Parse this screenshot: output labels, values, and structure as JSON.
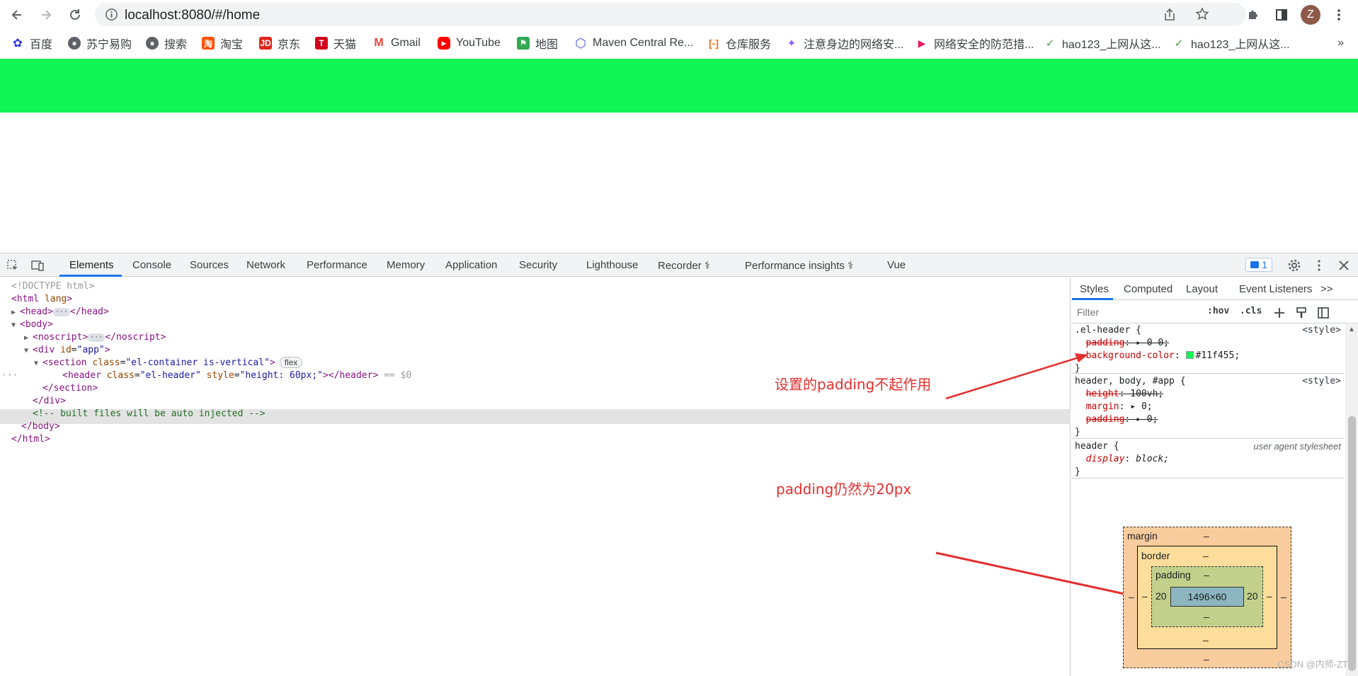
{
  "browser": {
    "url": "localhost:8080/#/home",
    "avatar_initial": "Z"
  },
  "bookmarks": [
    {
      "label": "百度",
      "icon": "baidu-icon",
      "color": "#2932e1"
    },
    {
      "label": "苏宁易购",
      "icon": "globe-icon",
      "color": "#5f6368"
    },
    {
      "label": "搜索",
      "icon": "globe-icon",
      "color": "#5f6368"
    },
    {
      "label": "淘宝",
      "icon": "taobao-icon",
      "color": "#ff5000"
    },
    {
      "label": "京东",
      "icon": "jd-icon",
      "color": "#e1251b"
    },
    {
      "label": "天猫",
      "icon": "tmall-icon",
      "color": "#d0021b"
    },
    {
      "label": "Gmail",
      "icon": "gmail-icon",
      "color": "#ea4335"
    },
    {
      "label": "YouTube",
      "icon": "youtube-icon",
      "color": "#ff0000"
    },
    {
      "label": "地图",
      "icon": "maps-icon",
      "color": "#34a853"
    },
    {
      "label": "Maven Central Re...",
      "icon": "maven-icon",
      "color": "#4f5bd5"
    },
    {
      "label": "仓库服务",
      "icon": "aliyun-icon",
      "color": "#ff6a00"
    },
    {
      "label": "注意身边的网络安...",
      "icon": "bilibili-icon",
      "color": "#8a5cf6"
    },
    {
      "label": "网络安全的防范措...",
      "icon": "play-icon",
      "color": "#e91e63"
    },
    {
      "label": "hao123_上网从这...",
      "icon": "hao123-icon",
      "color": "#3ca63c"
    },
    {
      "label": "hao123_上网从这...",
      "icon": "hao123-icon",
      "color": "#3ca63c"
    }
  ],
  "bookmarks_more": "»",
  "page": {
    "header_color": "#11f455"
  },
  "devtools": {
    "tabs": [
      "Elements",
      "Console",
      "Sources",
      "Network",
      "Performance",
      "Memory",
      "Application",
      "Security",
      "Lighthouse",
      "Recorder",
      "Performance insights",
      "Vue"
    ],
    "active_tab": "Elements",
    "issues_count": "1",
    "dom": {
      "doctype": "<!DOCTYPE html>",
      "html_open": "html",
      "html_attr": "lang",
      "head": "head",
      "head_close": "</head>",
      "body": "body",
      "noscript": "noscript",
      "noscript_close": "</noscript>",
      "div": "div",
      "div_attr": "id",
      "div_val": "\"app\"",
      "section": "section",
      "section_attr": "class",
      "section_val": "\"el-container is-vertical\"",
      "flex_badge": "flex",
      "header": "header",
      "header_attr1": "class",
      "header_val1": "\"el-header\"",
      "header_attr2": "style",
      "header_val2": "\"height: 60px;\"",
      "header_close": "</header>",
      "selected_marker": "== $0",
      "section_close": "</section>",
      "div_close": "</div>",
      "comment": "<!-- built files will be auto injected -->",
      "body_close": "</body>",
      "html_close": "</html>"
    },
    "annotations": {
      "note1": "设置的padding不起作用",
      "note2": "padding仍然为20px"
    },
    "styles": {
      "tabs": [
        "Styles",
        "Computed",
        "Layout",
        "Event Listeners"
      ],
      "tabs_more": ">>",
      "filter_placeholder": "Filter",
      "hov": ":hov",
      "cls": ".cls",
      "rules": [
        {
          "selector": ".el-header {",
          "source": "<style>",
          "props": [
            {
              "name": "padding",
              "value": "0 0;",
              "struck": true
            },
            {
              "name": "background-color",
              "value": "#11f455;",
              "struck": false,
              "swatch": true
            }
          ]
        },
        {
          "selector": "header, body, #app {",
          "source": "<style>",
          "props": [
            {
              "name": "height",
              "value": "100vh;",
              "struck": true
            },
            {
              "name": "margin",
              "value": "0;",
              "struck": false,
              "arrow": true
            },
            {
              "name": "padding",
              "value": "0;",
              "struck": true,
              "arrow": true
            }
          ]
        },
        {
          "selector": "header {",
          "source": "user agent stylesheet",
          "props": [
            {
              "name": "display",
              "value": "block;",
              "struck": false
            }
          ]
        }
      ]
    },
    "box_model": {
      "margin_label": "margin",
      "border_label": "border",
      "padding_label": "padding",
      "dash": "–",
      "padding_left": "20",
      "padding_right": "20",
      "content": "1496×60"
    }
  },
  "watermark": "CSDN @内师-ZT"
}
